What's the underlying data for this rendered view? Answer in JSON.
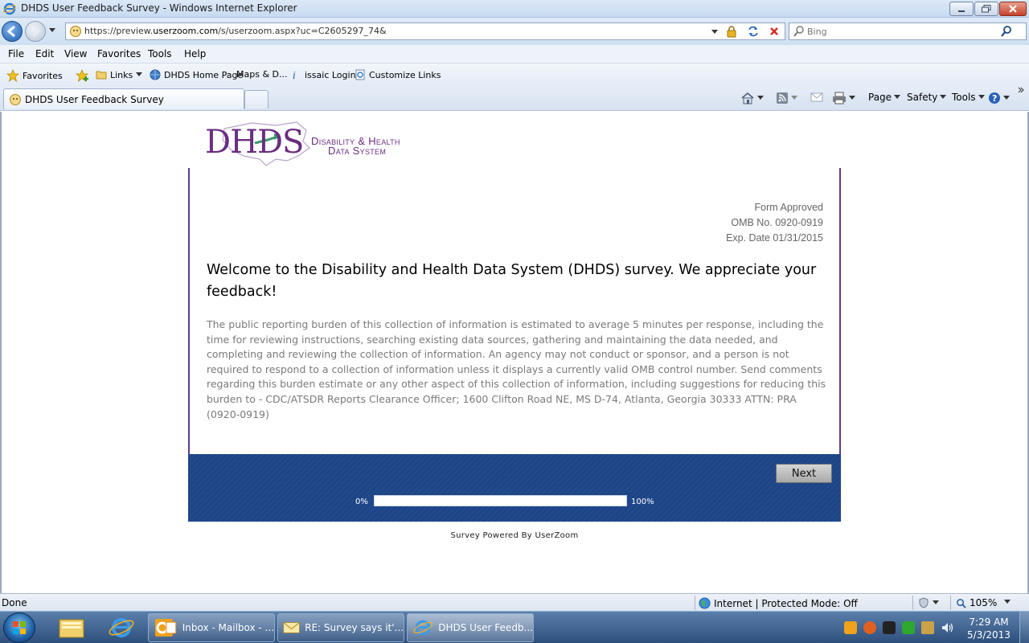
{
  "window": {
    "title": "DHDS User Feedback Survey - Windows Internet Explorer"
  },
  "address": {
    "url_prefix": "https://preview.",
    "url_domain": "userzoom.com",
    "url_rest": "/s/userzoom.aspx?uc=C2605297_74&"
  },
  "search": {
    "placeholder": "Bing"
  },
  "menu": [
    "File",
    "Edit",
    "View",
    "Favorites",
    "Tools",
    "Help"
  ],
  "favorites": {
    "label": "Favorites",
    "links": "Links",
    "items": [
      "DHDS Home Page",
      "Maps & D...",
      "issaic Login",
      "Customize Links"
    ]
  },
  "tab": {
    "label": "DHDS User Feedback Survey"
  },
  "commands": {
    "page": "Page",
    "safety": "Safety",
    "tools": "Tools"
  },
  "logo": {
    "mark": "DHDS",
    "line1": "Disability & Health",
    "line2": "Data System"
  },
  "form": {
    "approved": "Form Approved",
    "omb": "OMB No. 0920-0919",
    "exp": "Exp. Date 01/31/2015",
    "welcome": "Welcome to the Disability and Health Data System (DHDS) survey. We appreciate your feedback!",
    "burden": "The public reporting burden of this collection of information is estimated to average 5 minutes per response, including the time for reviewing instructions, searching existing data sources, gathering and maintaining the data needed, and completing and reviewing the collection of information. An agency may not conduct or sponsor, and a person is not required to respond to a collection of information unless it displays a currently valid OMB control number. Send comments regarding this burden estimate or any other aspect of this collection of information, including suggestions for reducing this burden to - CDC/ATSDR Reports Clearance Officer; 1600 Clifton Road NE, MS D-74, Atlanta, Georgia 30333 ATTN: PRA (0920-0919)"
  },
  "survey": {
    "next_label": "Next",
    "progress_min": "0%",
    "progress_max": "100%",
    "progress_value": 0,
    "powered_by": "Survey Powered By UserZoom"
  },
  "status": {
    "text": "Done",
    "zone": "Internet | Protected Mode: Off",
    "zoom": "105%"
  },
  "taskbar": {
    "buttons": [
      "Inbox - Mailbox - ...",
      "RE: Survey says it'...",
      "DHDS User Feedb..."
    ],
    "time": "7:29 AM",
    "date": "5/3/2013"
  },
  "colors": {
    "brand_purple": "#6b2d82",
    "footer_blue": "#214a8d"
  }
}
